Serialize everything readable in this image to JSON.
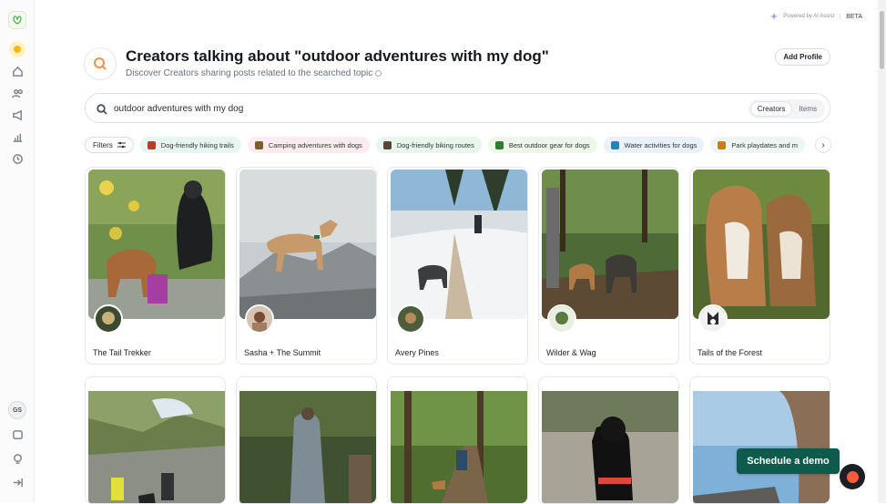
{
  "header": {
    "powered_by": "Powered by AI Assist",
    "beta": "BETA",
    "title": "Creators talking about \"outdoor adventures with my dog\"",
    "subtitle": "Discover Creators sharing posts related to the searched topic",
    "add_profile": "Add Profile"
  },
  "search": {
    "query": "outdoor adventures with my dog",
    "tabs": [
      {
        "label": "Creators",
        "active": true
      },
      {
        "label": "Items",
        "active": false
      }
    ]
  },
  "filters": {
    "label": "Filters",
    "chips": [
      {
        "label": "Dog-friendly hiking trails",
        "bg": "#e8f6f1",
        "icon_color": "#c0392b"
      },
      {
        "label": "Camping adventures with dogs",
        "bg": "#fdecef",
        "icon_color": "#7b5e2e"
      },
      {
        "label": "Dog-friendly biking routes",
        "bg": "#e9f6ee",
        "icon_color": "#5a4634"
      },
      {
        "label": "Best outdoor gear for dogs",
        "bg": "#eef7ea",
        "icon_color": "#2e7d32"
      },
      {
        "label": "Water activities for dogs",
        "bg": "#e9f1fb",
        "icon_color": "#1e88b5"
      },
      {
        "label": "Park playdates and m",
        "bg": "#eef6f4",
        "icon_color": "#c77d1a"
      }
    ]
  },
  "creators": [
    {
      "name": "The Tail Trekker"
    },
    {
      "name": "Sasha + The Summit"
    },
    {
      "name": "Avery Pines"
    },
    {
      "name": "Wilder & Wag"
    },
    {
      "name": "Tails of the Forest"
    }
  ],
  "sidebar": {
    "avatar_initials": "GS",
    "icons": [
      "home-icon",
      "users-icon",
      "megaphone-icon",
      "chart-icon",
      "clock-icon",
      "chat-icon",
      "bulb-icon",
      "collapse-icon"
    ]
  },
  "cta": {
    "schedule_demo": "Schedule a demo"
  },
  "colors": {
    "accent_orange": "#ef8f4f",
    "demo_green": "#0e5a4d"
  }
}
